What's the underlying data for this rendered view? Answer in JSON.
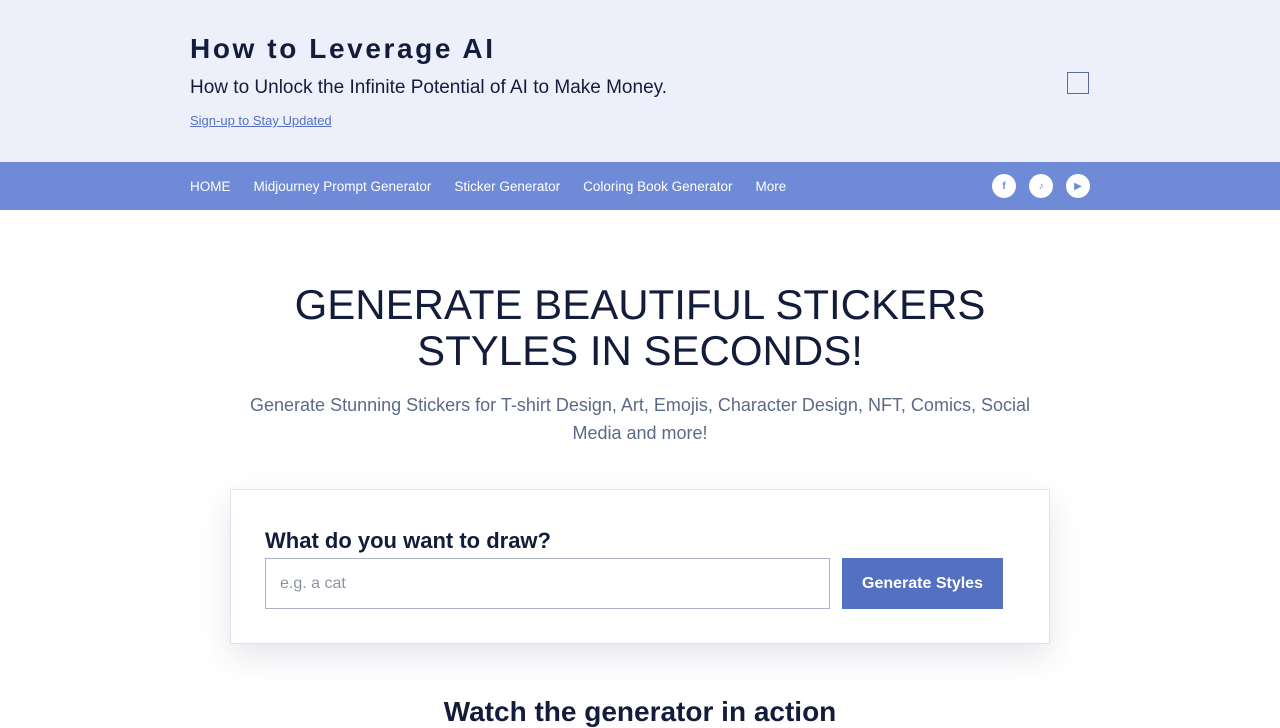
{
  "header": {
    "title": "How to Leverage AI",
    "tagline": "How to Unlock the Infinite Potential of AI to Make Money.",
    "signup_link": "Sign-up to Stay Updated"
  },
  "nav": {
    "items": [
      {
        "label": "HOME"
      },
      {
        "label": "Midjourney Prompt Generator"
      },
      {
        "label": "Sticker Generator"
      },
      {
        "label": "Coloring Book Generator"
      },
      {
        "label": "More"
      }
    ],
    "social": {
      "facebook": "f",
      "tiktok": "♪",
      "youtube": "▶"
    }
  },
  "hero": {
    "title": "GENERATE BEAUTIFUL STICKERS STYLES IN SECONDS!",
    "subtitle": "Generate Stunning Stickers for T-shirt Design, Art, Emojis, Character Design, NFT, Comics, Social Media and more!"
  },
  "form": {
    "label": "What do you want to draw?",
    "placeholder": "e.g. a cat",
    "value": "",
    "button_label": "Generate Styles"
  },
  "section": {
    "title": "Watch the generator in action"
  },
  "colors": {
    "header_bg": "#edf0fb",
    "nav_bg": "#6f8ad6",
    "accent": "#5470c0",
    "text_dark": "#131d3b",
    "text_muted": "#5b6a87"
  }
}
